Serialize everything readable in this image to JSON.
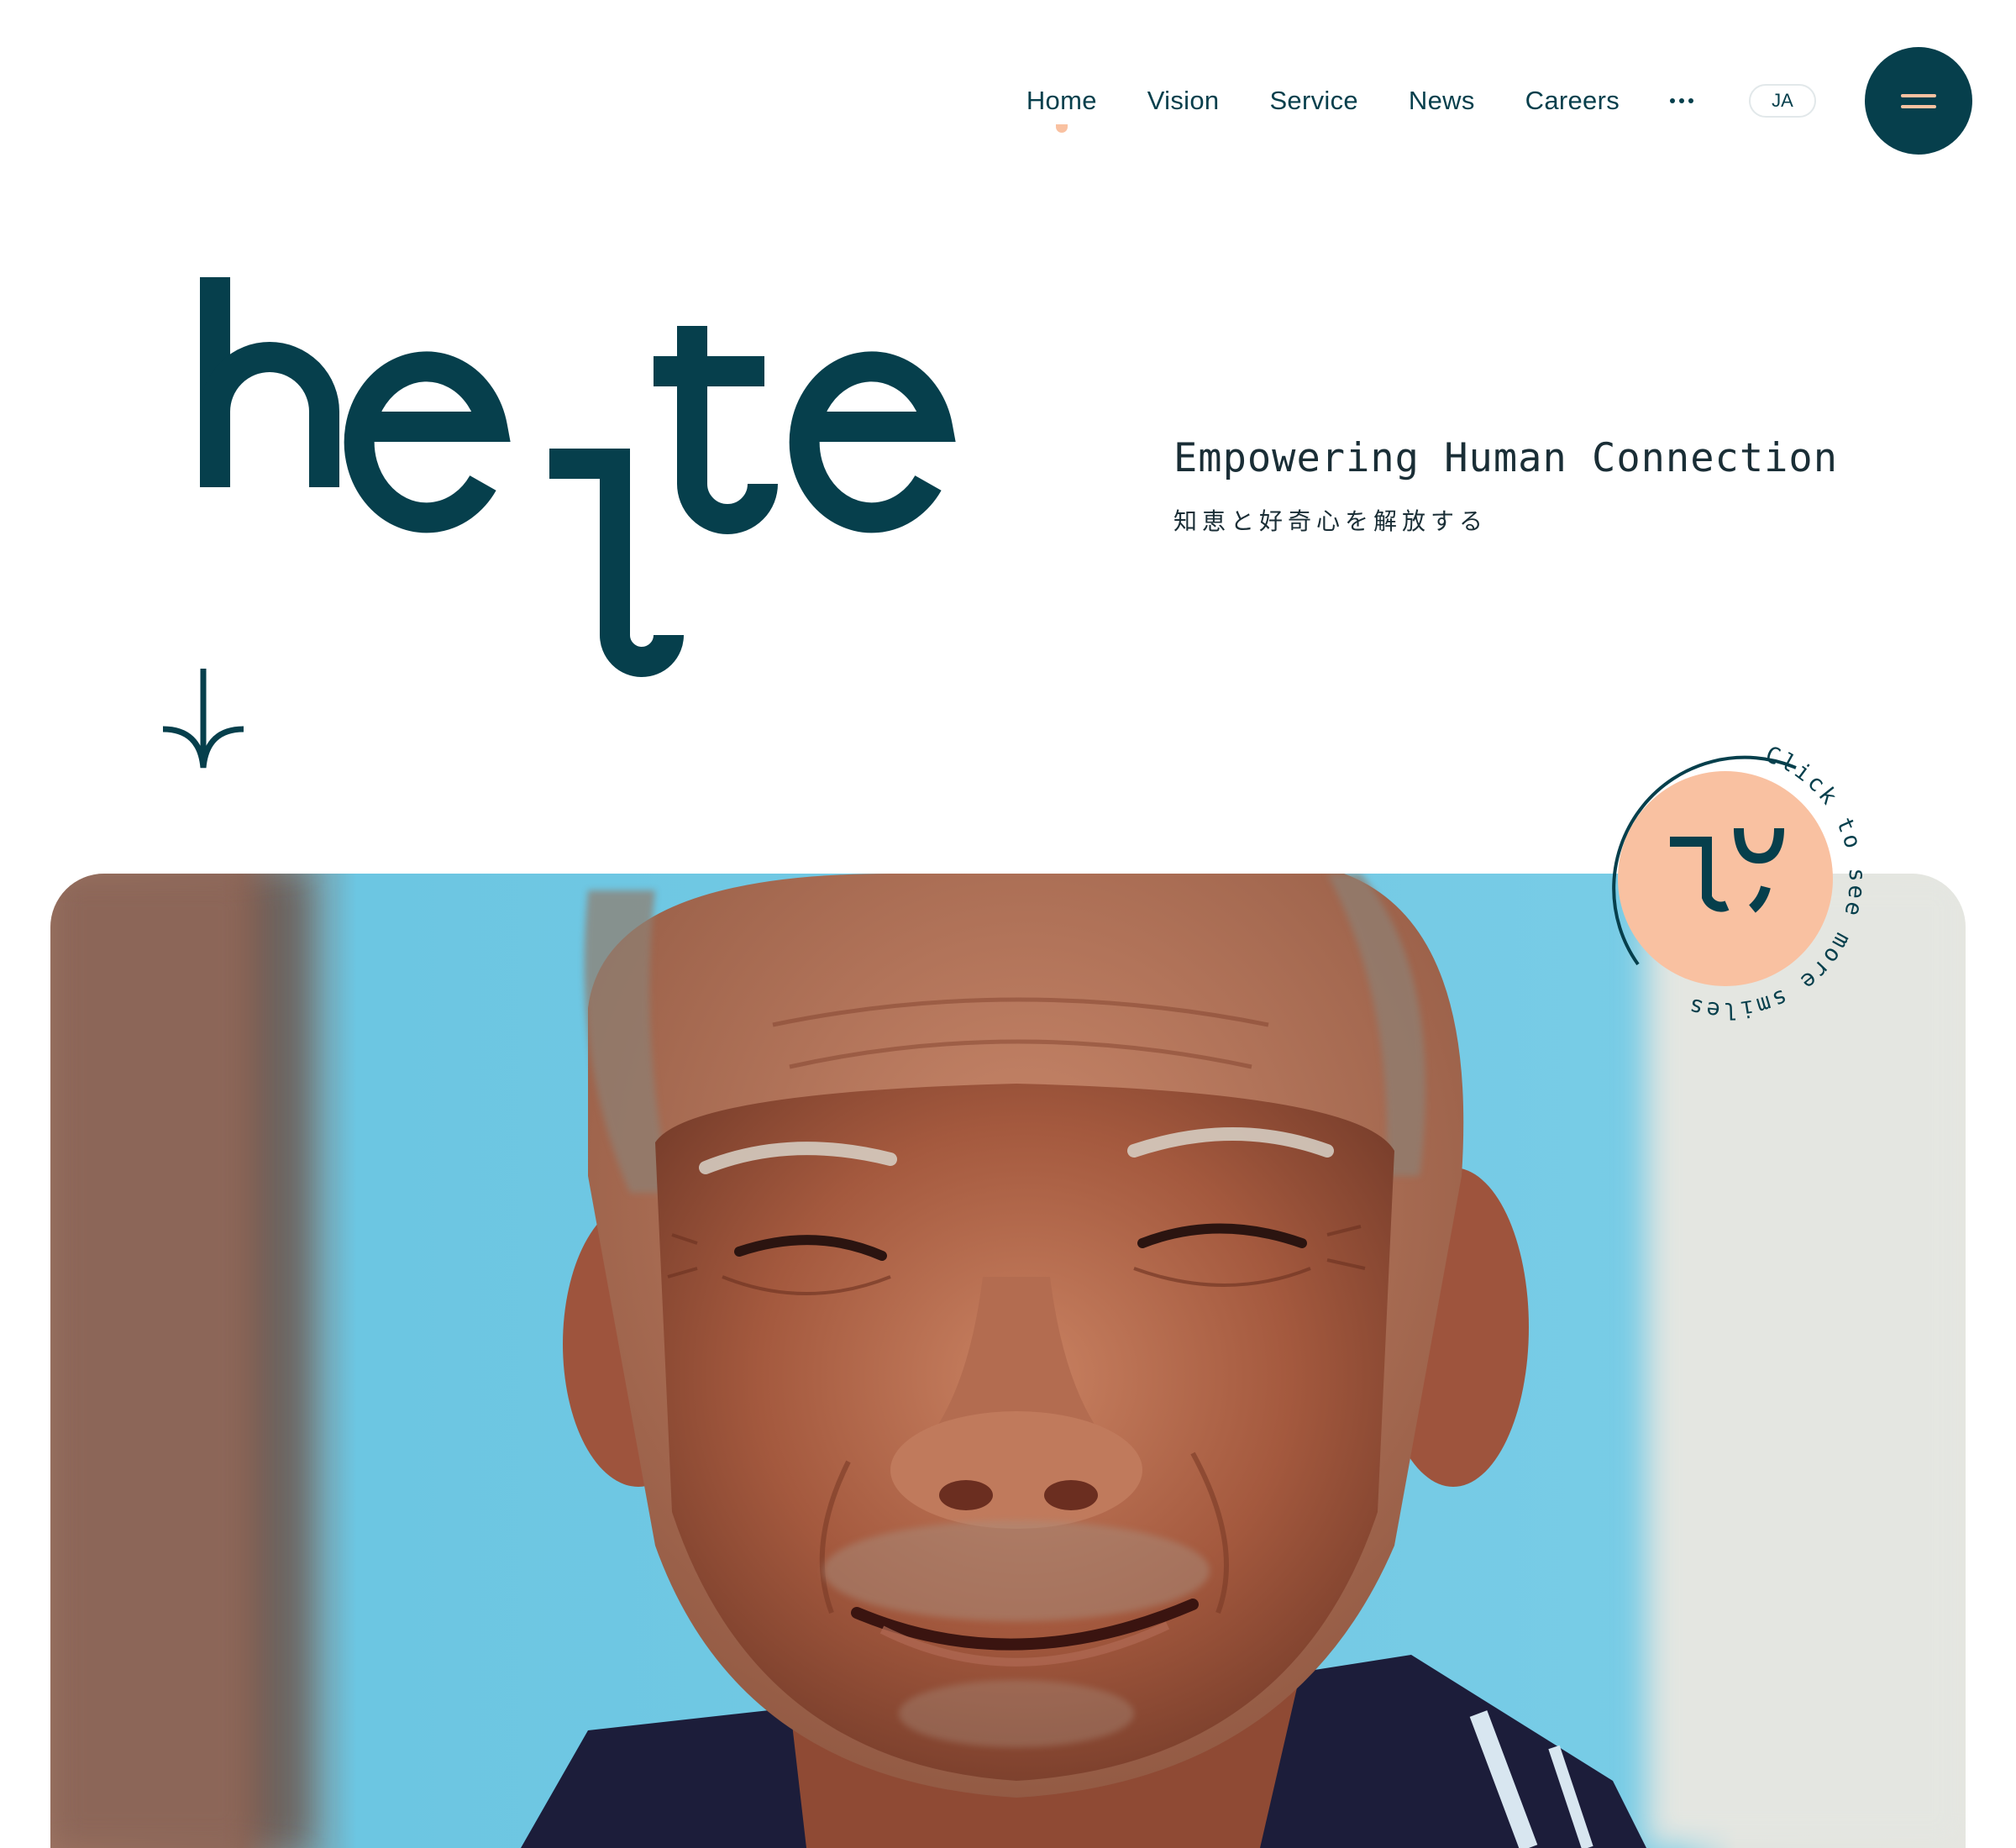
{
  "nav": {
    "items": [
      {
        "label": "Home",
        "active": true
      },
      {
        "label": "Vision"
      },
      {
        "label": "Service"
      },
      {
        "label": "News"
      },
      {
        "label": "Careers"
      }
    ],
    "more_icon": "ellipsis-icon",
    "lang": "JA",
    "menu_icon": "hamburger-menu-icon"
  },
  "brand": {
    "logo_text": "heте",
    "colors": {
      "primary": "#063f4c",
      "accent": "#f9c1a1",
      "sky": "#6ec9e6"
    }
  },
  "hero": {
    "tagline_en": "Empowering Human Connection",
    "tagline_ja": "知恵と好奇心を解放する",
    "scroll_icon": "arrow-down-icon",
    "photo_icon": "smiling-elderly-man-photo"
  },
  "badge": {
    "text": "Click to see more smiles",
    "icon": "smile-face-icon"
  }
}
